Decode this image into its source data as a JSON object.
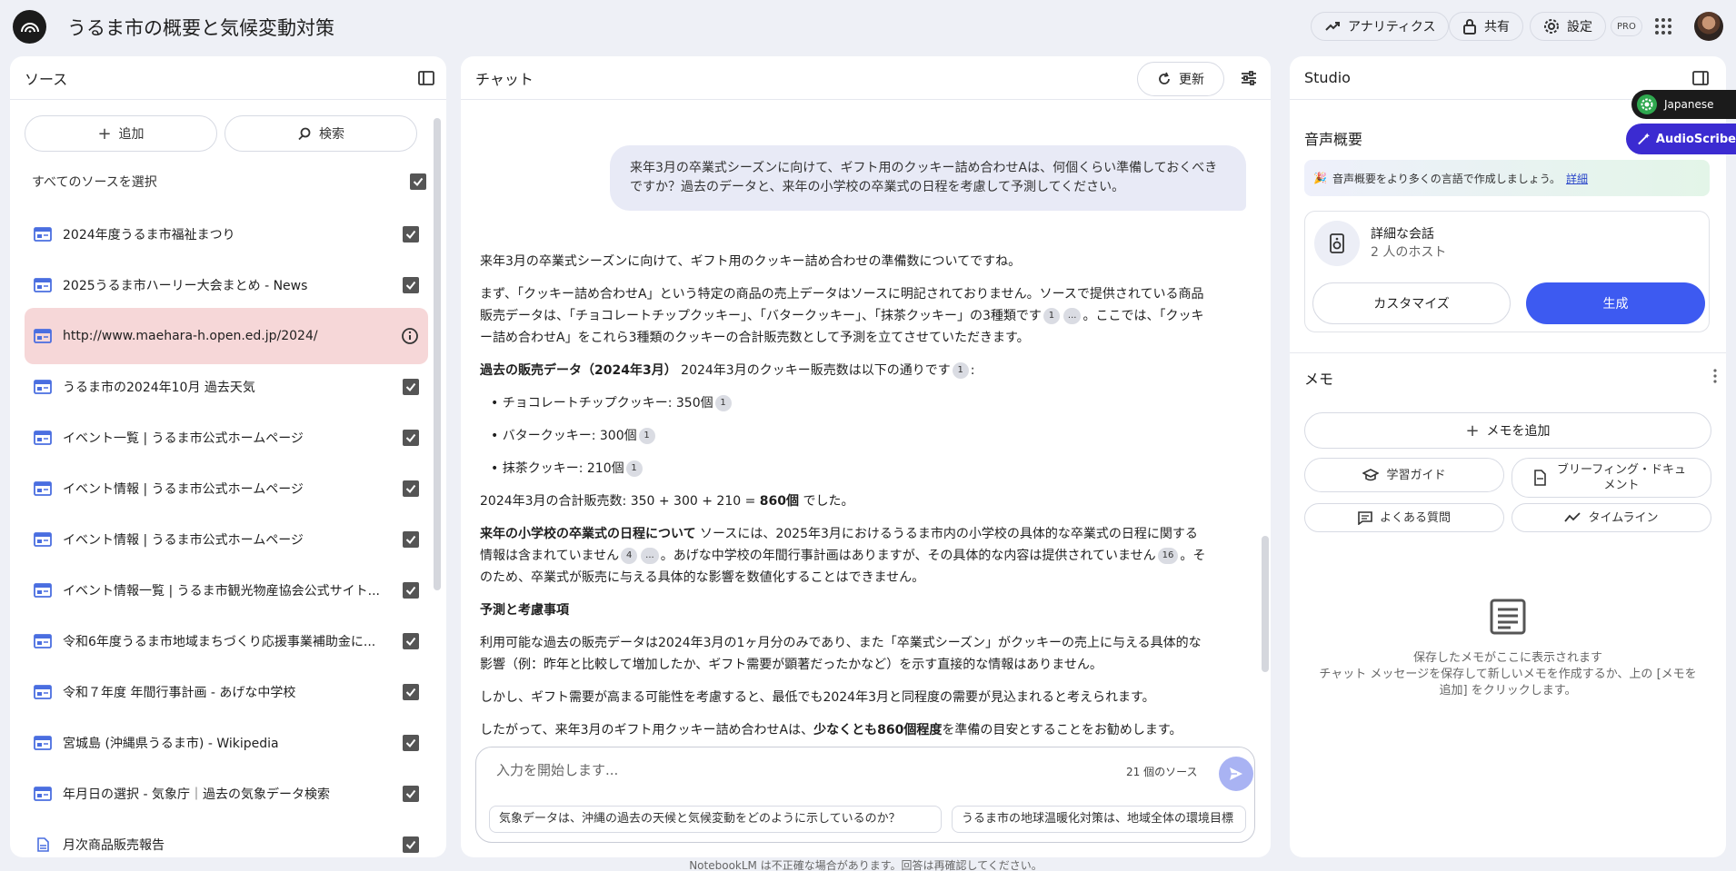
{
  "header": {
    "title": "うるま市の概要と気候変動対策",
    "analytics_label": "アナリティクス",
    "share_label": "共有",
    "settings_label": "設定",
    "pro_badge": "PRO"
  },
  "sources": {
    "title": "ソース",
    "add_label": "追加",
    "search_label": "検索",
    "select_all_label": "すべてのソースを選択",
    "items": [
      {
        "label": "2024年度うるま市福祉まつり"
      },
      {
        "label": "2025うるま市ハーリー大会まとめ - News"
      },
      {
        "label": "http://www.maehara-h.open.ed.jp/2024/"
      },
      {
        "label": "うるま市の2024年10月 過去天気"
      },
      {
        "label": "イベント一覧 | うるま市公式ホームページ"
      },
      {
        "label": "イベント情報 | うるま市公式ホームページ"
      },
      {
        "label": "イベント情報 | うるま市公式ホームページ"
      },
      {
        "label": "イベント情報一覧 | うるま市観光物産協会公式サイト..."
      },
      {
        "label": "令和6年度うるま市地域まちづくり応援事業補助金に..."
      },
      {
        "label": "令和７年度 年間行事計画 - あげな中学校"
      },
      {
        "label": "宮城島 (沖縄県うるま市) - Wikipedia"
      },
      {
        "label": "年月日の選択 - 気象庁｜過去の気象データ検索"
      },
      {
        "label": "月次商品販売報告"
      }
    ]
  },
  "chat": {
    "title": "チャット",
    "refresh_label": "更新",
    "user_message": "来年3月の卒業式シーズンに向けて、ギフト用のクッキー詰め合わせAは、何個くらい準備しておくべきですか？過去のデータと、来年の小学校の卒業式の日程を考慮して予測してください。",
    "answer": {
      "p1": "来年3月の卒業式シーズンに向けて、ギフト用のクッキー詰め合わせの準備数についてですね。",
      "p2a": "まず、「クッキー詰め合わせA」という特定の商品の売上データはソースに明記されておりません。ソースで提供されている商品販売データは、「チョコレートチップクッキー」、「バタークッキー」、「抹茶クッキー」の3種類です",
      "p2b": "。ここでは、「クッキー詰め合わせA」をこれら3種類のクッキーの合計販売数として予測を立てさせていただきます。",
      "h_past": "過去の販売データ（2024年3月）",
      "past_text": " 2024年3月のクッキー販売数は以下の通りです",
      "b1": "• チョコレートチップクッキー: 350個",
      "b2": "• バタークッキー: 300個",
      "b3": "• 抹茶クッキー: 210個",
      "total_a": "2024年3月の合計販売数: 350 + 300 + 210 = ",
      "total_b": "860個",
      "total_c": " でした。",
      "h_school": "来年の小学校の卒業式の日程について",
      "school_a": " ソースには、2025年3月におけるうるま市内の小学校の具体的な卒業式の日程に関する情報は含まれていません",
      "school_b": "。あげな中学校の年間行事計画はありますが、その具体的な内容は提供されていません",
      "school_c": "。そのため、卒業式が販売に与える具体的な影響を数値化することはできません。",
      "h_predict": "予測と考慮事項",
      "predict1": "利用可能な過去の販売データは2024年3月の1ヶ月分のみであり、また「卒業式シーズン」がクッキーの売上に与える具体的な影響（例：昨年と比較して増加したか、ギフト需要が顕著だったかなど）を示す直接的な情報はありません。",
      "predict2": "しかし、ギフト需要が高まる可能性を考慮すると、最低でも2024年3月と同程度の需要が見込まれると考えられます。",
      "final_a": "したがって、来年3月のギフト用クッキー詰め合わせAは、",
      "final_b": "少なくとも860個程度",
      "final_c": "を準備の目安とすることをお勧めします。"
    },
    "citations": {
      "c1": "1",
      "more": "...",
      "c4": "4",
      "c16": "16"
    },
    "input_placeholder": "入力を開始します...",
    "source_count": "21 個のソース",
    "suggestions": [
      "気象データは、沖縄の過去の天候と気候変動をどのように示しているのか？",
      "うるま市の地球温暖化対策は、地域全体の環境目標"
    ],
    "disclaimer": "NotebookLM は不正確な場合があります。回答は再確認してください。"
  },
  "studio": {
    "title": "Studio",
    "ext_japanese": "Japanese",
    "ext_audioscribe": "AudioScribe",
    "audio_title": "音声概要",
    "banner_text": "音声概要をより多くの言語で作成しましょう。",
    "banner_link": "詳細",
    "audio_card_title": "詳細な会話",
    "audio_card_sub": "2 人のホスト",
    "customize_label": "カスタマイズ",
    "generate_label": "生成",
    "notes_title": "メモ",
    "add_note_label": "メモを追加",
    "note_buttons": [
      "学習ガイド",
      "ブリーフィング・ドキュメント",
      "よくある質問",
      "タイムライン"
    ],
    "empty_title": "保存したメモがここに表示されます",
    "empty_desc": "チャット メッセージを保存して新しいメモを作成するか、上の [メモを追加] をクリックします。"
  },
  "colors": {
    "accent": "#3d5af1",
    "selected_source": "#f6d7d8",
    "background": "#eef0f6"
  }
}
